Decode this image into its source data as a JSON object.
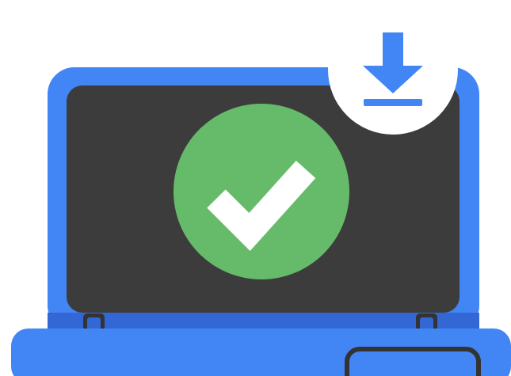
{
  "illustration": {
    "subject": "laptop-download-complete",
    "icons": {
      "status": "checkmark-icon",
      "badge": "download-arrow-icon"
    },
    "colors": {
      "background": "#ffffff",
      "laptop_frame": "#4285f4",
      "laptop_frame_shadow": "#3367d6",
      "screen": "#3c3c3c",
      "success": "#66bb6a",
      "check": "#ffffff",
      "badge_circle": "#ffffff",
      "download_arrow": "#4285f4",
      "outline": "#333333"
    }
  }
}
